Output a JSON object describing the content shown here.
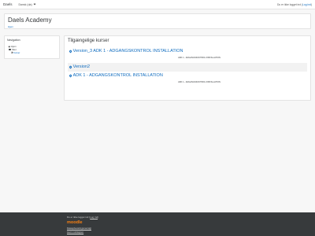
{
  "navbar": {
    "brand": "Daels",
    "language": "Dansk (da)",
    "login_prefix": "Du er ikke logget ind (",
    "login_link": "Log ind",
    "login_suffix": ")"
  },
  "header": {
    "title": "Daels Academy",
    "breadcrumb": "Hjem"
  },
  "navigation_block": {
    "title": "Navigation",
    "items": [
      {
        "label": "Hjem"
      },
      {
        "label": "Sitet"
      },
      {
        "label": "Kurser"
      }
    ]
  },
  "main": {
    "heading": "Tilgængelige kurser",
    "courses": [
      {
        "name": "Version_3 ADK 1 - ADGANGSKONTROL INSTALLATION",
        "summary": "ADK 1 - ADGANGSKONTROL INSTALLATION"
      },
      {
        "name": "Version2",
        "summary": ""
      },
      {
        "name": "ADK 1 - ADGANGSKONTROL INSTALLATION",
        "summary": "ADK 1 - ADGANGSKONTROL INSTALLATION"
      }
    ]
  },
  "footer": {
    "login_prefix": "Du er ikke logget ind (",
    "login_link": "Log ind",
    "login_suffix": ")",
    "logo": "moodle",
    "links": [
      "Dataopbevaringsoversigt",
      "Hent mobilappen"
    ]
  },
  "colors": {
    "link": "#0f6cbf",
    "footer_bg": "#373a3c",
    "moodle_orange": "#f98012"
  }
}
